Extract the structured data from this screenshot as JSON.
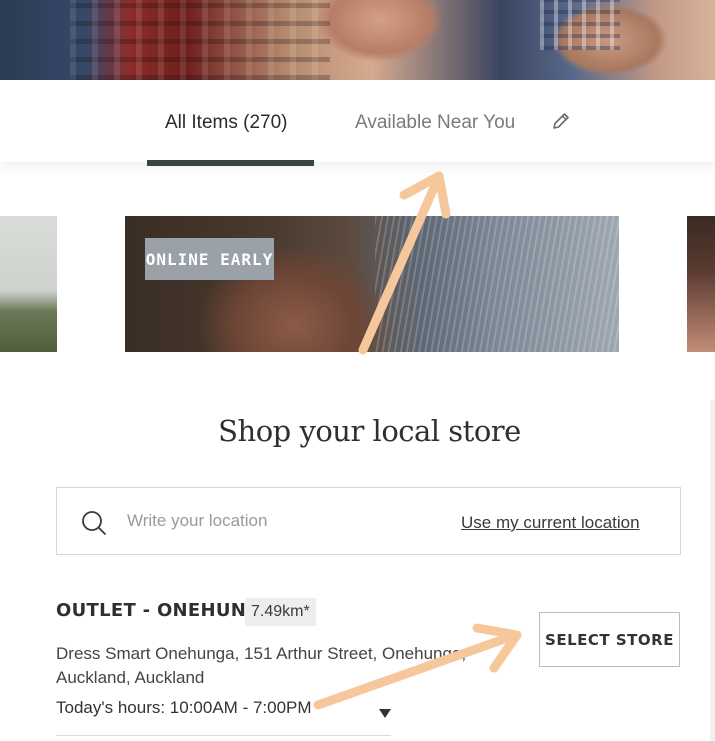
{
  "tabs": {
    "all_items": "All Items (270)",
    "available_near_you": "Available Near You"
  },
  "carousel": {
    "badge": "ONLINE EARLY"
  },
  "store_finder": {
    "heading": "Shop your local store",
    "search_placeholder": "Write your location",
    "use_location": "Use my current location",
    "store": {
      "name": "OUTLET - ONEHUNGA",
      "distance": "7.49km*",
      "address": "Dress Smart Onehunga, 151 Arthur Street, Onehunga, Auckland, Auckland",
      "hours": "Today's hours: 10:00AM - 7:00PM",
      "select_label": "SELECT STORE"
    }
  },
  "colors": {
    "annotation_arrow": "#f7c79c",
    "tab_underline": "#3b4444",
    "badge_bg": "#9aa1a8"
  },
  "icons": {
    "edit": "pencil-icon",
    "search": "search-icon",
    "hours_toggle": "caret-down-icon"
  }
}
